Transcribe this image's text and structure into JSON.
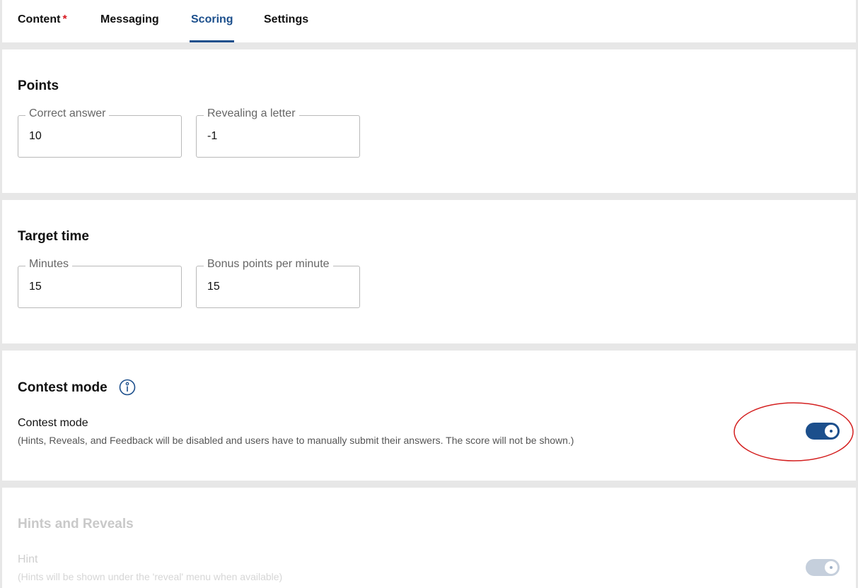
{
  "tabs": [
    {
      "label": "Content",
      "required_marker": "*"
    },
    {
      "label": "Messaging"
    },
    {
      "label": "Scoring"
    },
    {
      "label": "Settings"
    }
  ],
  "active_tab": "Scoring",
  "accent_color": "#1c4f8c",
  "points": {
    "title": "Points",
    "correct_answer": {
      "label": "Correct answer",
      "value": "10"
    },
    "revealing_letter": {
      "label": "Revealing a letter",
      "value": "-1"
    }
  },
  "target_time": {
    "title": "Target time",
    "minutes": {
      "label": "Minutes",
      "value": "15"
    },
    "bonus": {
      "label": "Bonus points per minute",
      "value": "15"
    }
  },
  "contest_mode": {
    "title": "Contest mode",
    "info_icon": "info-icon",
    "toggle_label": "Contest mode",
    "toggle_desc": "(Hints, Reveals, and Feedback will be disabled and users have to manually submit their answers. The score will not be shown.)",
    "toggle_on": true,
    "annotation_color": "#d42020"
  },
  "hints_reveals": {
    "title": "Hints and Reveals",
    "hint_label": "Hint",
    "hint_desc": "(Hints will be shown under the 'reveal' menu when available)",
    "hint_on": true,
    "disabled": true
  }
}
